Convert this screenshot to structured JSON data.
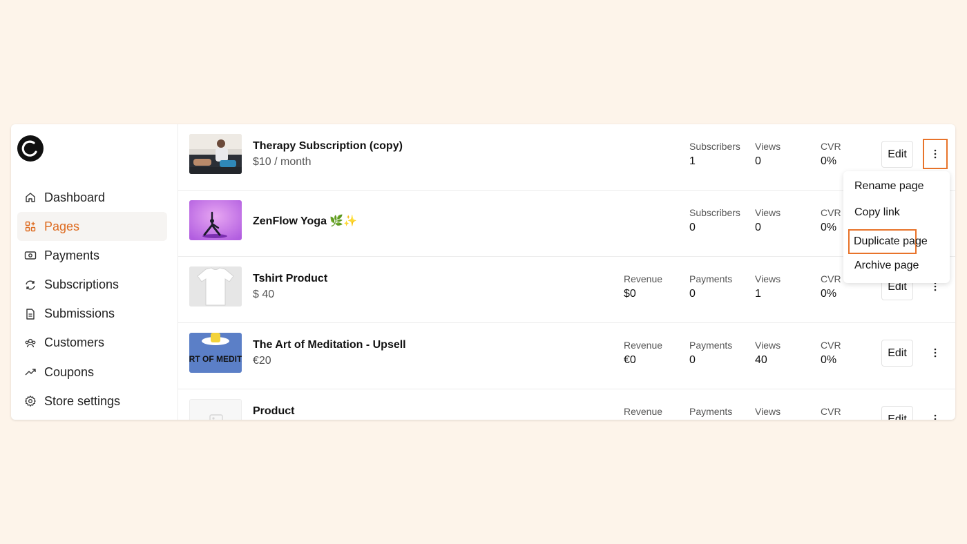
{
  "sidebar": {
    "logo": "logo-icon",
    "items": [
      {
        "label": "Dashboard",
        "icon": "home-icon",
        "active": false
      },
      {
        "label": "Pages",
        "icon": "grid-icon",
        "active": true
      },
      {
        "label": "Payments",
        "icon": "money-icon",
        "active": false
      },
      {
        "label": "Subscriptions",
        "icon": "refresh-icon",
        "active": false
      },
      {
        "label": "Submissions",
        "icon": "document-icon",
        "active": false
      },
      {
        "label": "Customers",
        "icon": "users-icon",
        "active": false
      },
      {
        "label": "Coupons",
        "icon": "trending-icon",
        "active": false
      },
      {
        "label": "Store settings",
        "icon": "gear-icon",
        "active": false
      }
    ]
  },
  "pages": [
    {
      "title": "Therapy Subscription (copy)",
      "subtitle": "$10 / month",
      "stats": [
        {
          "label": "Subscribers",
          "value": "1"
        },
        {
          "label": "Views",
          "value": "0"
        },
        {
          "label": "CVR",
          "value": "0%"
        }
      ],
      "edit": "Edit"
    },
    {
      "title": "ZenFlow Yoga 🌿✨",
      "subtitle": "",
      "stats": [
        {
          "label": "Subscribers",
          "value": "0"
        },
        {
          "label": "Views",
          "value": "0"
        },
        {
          "label": "CVR",
          "value": "0%"
        }
      ],
      "edit": "Edit"
    },
    {
      "title": "Tshirt Product",
      "subtitle": "$ 40",
      "stats": [
        {
          "label": "Revenue",
          "value": "$0"
        },
        {
          "label": "Payments",
          "value": "0"
        },
        {
          "label": "Views",
          "value": "1"
        },
        {
          "label": "CVR",
          "value": "0%"
        }
      ],
      "edit": "Edit"
    },
    {
      "title": "The Art of Meditation - Upsell",
      "subtitle": "€20",
      "thumb_text": "THE ART OF MEDITATION",
      "stats": [
        {
          "label": "Revenue",
          "value": "€0"
        },
        {
          "label": "Payments",
          "value": "0"
        },
        {
          "label": "Views",
          "value": "40"
        },
        {
          "label": "CVR",
          "value": "0%"
        }
      ],
      "edit": "Edit"
    },
    {
      "title": "Product",
      "subtitle": "",
      "stats": [
        {
          "label": "Revenue",
          "value": ""
        },
        {
          "label": "Payments",
          "value": ""
        },
        {
          "label": "Views",
          "value": ""
        },
        {
          "label": "CVR",
          "value": ""
        }
      ],
      "edit": "Edit"
    }
  ],
  "menu": {
    "items": [
      "Rename page",
      "Copy link",
      "Duplicate page",
      "Archive page"
    ]
  },
  "colors": {
    "accent": "#dd6a1f",
    "highlight": "#e8732a",
    "background": "#fdf4ea"
  }
}
